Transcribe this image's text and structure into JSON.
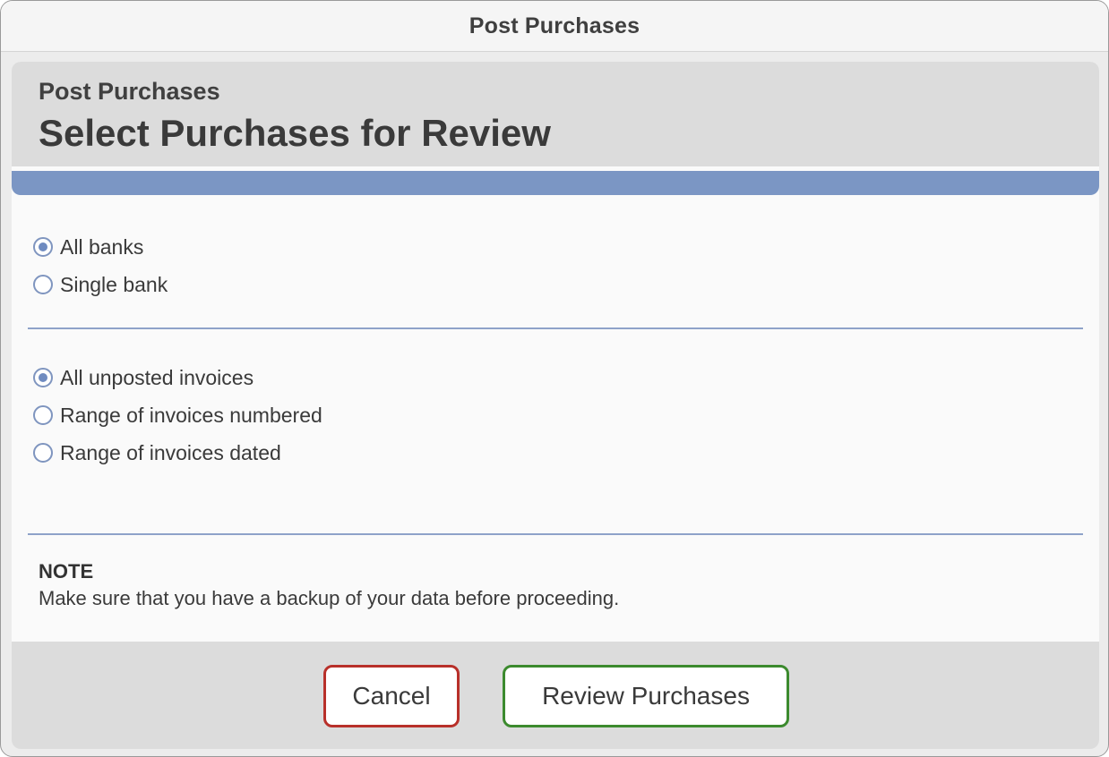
{
  "window": {
    "title": "Post Purchases"
  },
  "header": {
    "subtitle": "Post Purchases",
    "heading": "Select Purchases for Review"
  },
  "bank_options": [
    {
      "label": "All banks",
      "selected": true
    },
    {
      "label": "Single bank",
      "selected": false
    }
  ],
  "invoice_options": [
    {
      "label": "All unposted invoices",
      "selected": true
    },
    {
      "label": "Range of invoices numbered",
      "selected": false
    },
    {
      "label": "Range of invoices dated",
      "selected": false
    }
  ],
  "note": {
    "title": "NOTE",
    "text": "Make sure that you have a backup of your data before proceeding."
  },
  "buttons": {
    "cancel_label": "Cancel",
    "review_label": "Review Purchases"
  },
  "colors": {
    "accent_bar": "#7b96c4",
    "radio_selected": "#6f8bc0",
    "cancel_border": "#b8302a",
    "review_border": "#3c8a2e"
  }
}
